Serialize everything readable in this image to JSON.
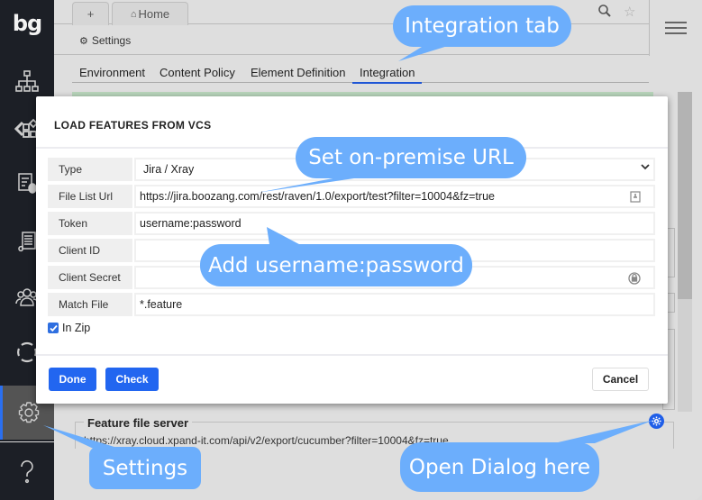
{
  "sidebar": {
    "logo": "bg",
    "items": [
      {
        "name": "sitemap",
        "active": false
      },
      {
        "name": "elements",
        "active": false
      },
      {
        "name": "test-bug",
        "active": false
      },
      {
        "name": "scroll-doc",
        "active": false
      },
      {
        "name": "users",
        "active": false
      },
      {
        "name": "sync",
        "active": false
      },
      {
        "name": "settings",
        "active": true
      },
      {
        "name": "help",
        "active": false
      }
    ]
  },
  "header": {
    "tabs": [
      {
        "label": "+"
      },
      {
        "label": "Home",
        "icon": "home-icon"
      }
    ],
    "breadcrumb": "Settings",
    "icons": [
      "search-icon",
      "star-icon",
      "menu-icon"
    ]
  },
  "subtabs": [
    {
      "label": "Environment",
      "active": false
    },
    {
      "label": "Content Policy",
      "active": false
    },
    {
      "label": "Element Definition",
      "active": false
    },
    {
      "label": "Integration",
      "active": true
    }
  ],
  "dialog": {
    "title": "LOAD FEATURES FROM VCS",
    "fields": [
      {
        "label": "Type",
        "value": "Jira / Xray",
        "kind": "select"
      },
      {
        "label": "File List Url",
        "value": "https://jira.boozang.com/rest/raven/1.0/export/test?filter=10004&fz=true",
        "kind": "text",
        "trailing_icon": "bookmark-icon"
      },
      {
        "label": "Token",
        "value": "username:password",
        "kind": "text"
      },
      {
        "label": "Client ID",
        "value": "",
        "kind": "text"
      },
      {
        "label": "Client Secret",
        "value": "",
        "kind": "text",
        "trailing_icon": "lock-icon"
      },
      {
        "label": "Match File",
        "value": "*.feature",
        "kind": "text"
      }
    ],
    "checkbox": {
      "label": "In Zip",
      "checked": true
    },
    "buttons": {
      "done": "Done",
      "check": "Check",
      "cancel": "Cancel"
    }
  },
  "background": {
    "fieldset_legend": "Feature file server",
    "fieldset_value": "https://xray.cloud.xpand-it.com/api/v2/export/cucumber?filter=10004&fz=true"
  },
  "annotations": {
    "integration_tab": "Integration tab",
    "set_url": "Set on-premise URL",
    "add_credentials": "Add username:password",
    "settings": "Settings",
    "open_dialog": "Open Dialog here"
  },
  "colors": {
    "accent": "#2266f0",
    "callout": "#6caefc",
    "sidebar": "#1c1f26"
  }
}
